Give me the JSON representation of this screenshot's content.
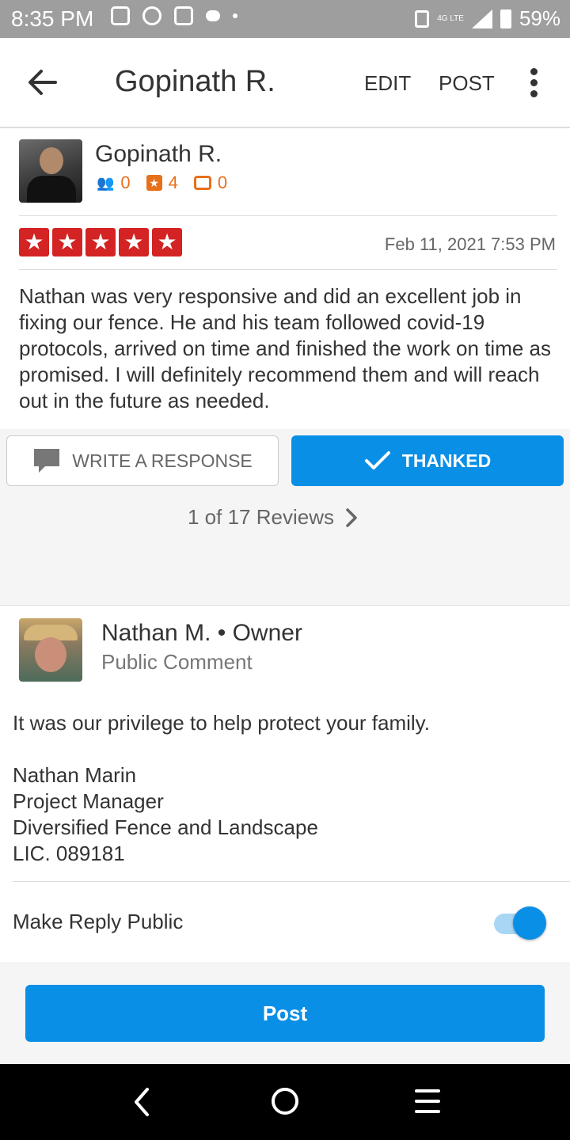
{
  "status_bar": {
    "time": "8:35 PM",
    "network": "4G LTE",
    "battery": "59%"
  },
  "header": {
    "title": "Gopinath R.",
    "edit": "EDIT",
    "post": "POST"
  },
  "review": {
    "reviewer": "Gopinath R.",
    "friends": "0",
    "reviews": "4",
    "photos": "0",
    "rating": 5,
    "date": "Feb 11, 2021 7:53 PM",
    "text": "Nathan was very responsive and did an excellent job in fixing our fence. He and his team followed covid-19 protocols, arrived on time and finished the work on time as promised. I will definitely recommend them and will reach out in the future as needed."
  },
  "actions": {
    "write_response": "WRITE A RESPONSE",
    "thanked": "THANKED",
    "pager": "1 of 17 Reviews"
  },
  "reply": {
    "owner_name": "Nathan M. • Owner",
    "comment_type": "Public Comment",
    "message": "It was our privilege to help protect your family.\n\nNathan Marin\nProject Manager\nDiversified Fence and Landscape\nLIC. 089181",
    "make_public_label": "Make Reply Public",
    "make_public": true
  },
  "post_button": "Post",
  "colors": {
    "accent": "#0a8fe6",
    "star_red": "#d32323",
    "stat_orange": "#e8701a"
  }
}
